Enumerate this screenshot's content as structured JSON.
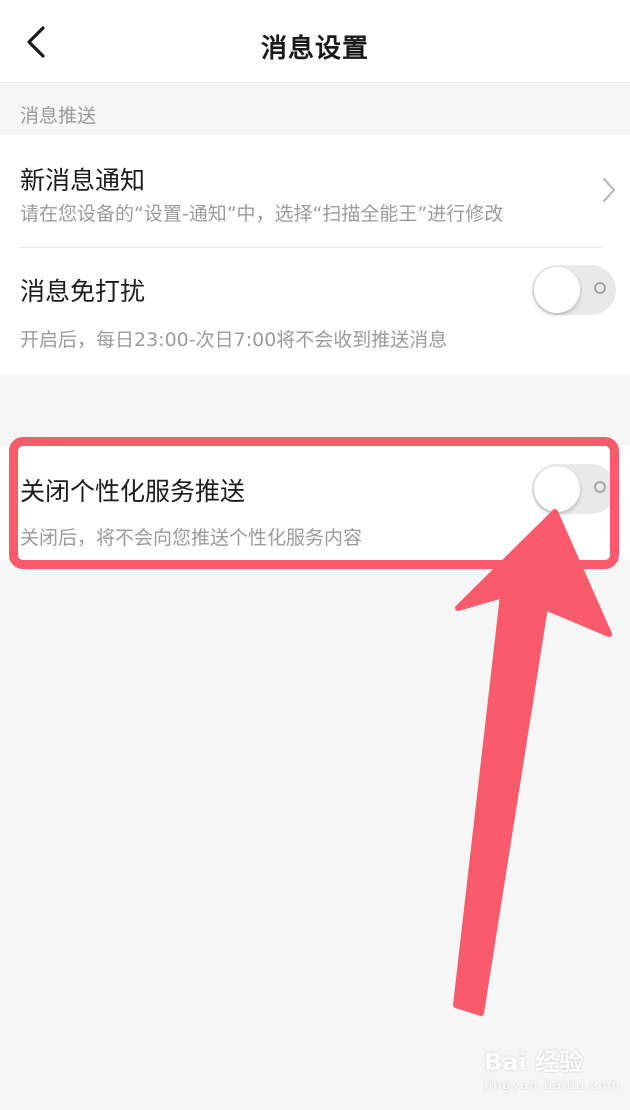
{
  "header": {
    "title": "消息设置",
    "back_icon": "chevron-left-icon"
  },
  "section": {
    "label": "消息推送"
  },
  "items": [
    {
      "title": "新消息通知",
      "subtitle": "请在您设备的“设置-通知”中，选择“扫描全能王”进行修改",
      "control": "chevron-right-icon"
    },
    {
      "title": "消息免打扰",
      "subtitle": "开启后，每日23:00-次日7:00将不会收到推送消息",
      "control": "toggle",
      "enabled": false
    },
    {
      "title": "关闭个性化服务推送",
      "subtitle": "关闭后，将不会向您推送个性化服务内容",
      "control": "toggle",
      "enabled": false
    }
  ],
  "annotation": {
    "highlight_color": "#f95a6c",
    "arrow_color": "#f95a6c"
  },
  "watermark": {
    "main": "Bai 经验",
    "url": "jingyan.baidu.com"
  },
  "colors": {
    "background": "#f6f6f6",
    "card": "#ffffff",
    "toggle_off": "#e9e9e9"
  }
}
